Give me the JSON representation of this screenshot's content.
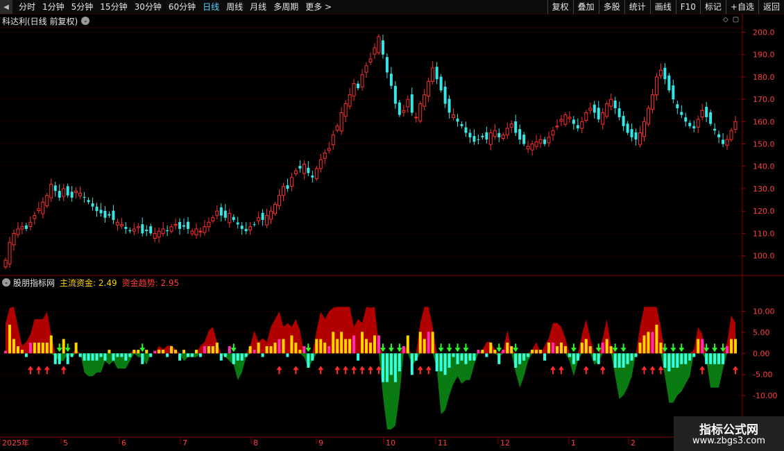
{
  "toolbar": {
    "back_glyph": "◀",
    "periods": [
      "分时",
      "1分钟",
      "5分钟",
      "15分钟",
      "30分钟",
      "60分钟",
      "日线",
      "周线",
      "月线",
      "多周期",
      "更多 >"
    ],
    "active_period": "日线",
    "buttons": [
      "复权",
      "叠加",
      "多股",
      "统计",
      "画线",
      "F10",
      "标记",
      "+自选",
      "返回"
    ]
  },
  "main_chart": {
    "title": "科达利(日线 前复权)",
    "dropdown_glyph": "⌄",
    "price_axis": {
      "labels": [
        "200.0",
        "190.0",
        "180.0",
        "170.0",
        "160.0",
        "150.0",
        "140.0",
        "130.0",
        "120.0",
        "110.0",
        "100.0"
      ],
      "values": [
        200,
        190,
        180,
        170,
        160,
        150,
        140,
        130,
        120,
        110,
        100
      ],
      "range": [
        91.5,
        202
      ]
    },
    "up_color": "#ff3030",
    "down_color": "#36e6e6",
    "candles_close": [
      98,
      106,
      110,
      112,
      113,
      112,
      115,
      118,
      121,
      124,
      127,
      132,
      129,
      126,
      130,
      127,
      126,
      129,
      128,
      126,
      124,
      122,
      120,
      119,
      117,
      118,
      116,
      115,
      114,
      112,
      111,
      112,
      113,
      110,
      111,
      110,
      110,
      111,
      112,
      111,
      113,
      114,
      112,
      113,
      112,
      111,
      112,
      111,
      113,
      115,
      117,
      120,
      118,
      117,
      119,
      116,
      114,
      112,
      111,
      113,
      114,
      117,
      116,
      118,
      120,
      123,
      127,
      131,
      130,
      135,
      138,
      139,
      141,
      137,
      135,
      139,
      143,
      146,
      148,
      154,
      158,
      164,
      168,
      172,
      177,
      175,
      181,
      185,
      188,
      193,
      198,
      190,
      182,
      176,
      168,
      163,
      165,
      170,
      164,
      162,
      168,
      172,
      178,
      184,
      179,
      174,
      168,
      164,
      163,
      160,
      158,
      155,
      153,
      151,
      152,
      153,
      152,
      155,
      156,
      153,
      154,
      157,
      159,
      155,
      152,
      150,
      149,
      150,
      151,
      152,
      150,
      153,
      156,
      158,
      161,
      163,
      162,
      159,
      157,
      160,
      164,
      166,
      164,
      161,
      164,
      168,
      170,
      166,
      162,
      158,
      155,
      153,
      152,
      155,
      160,
      166,
      172,
      180,
      183,
      179,
      174,
      170,
      166,
      163,
      160,
      158,
      157,
      161,
      165,
      162,
      159,
      156,
      153,
      150,
      152,
      156,
      160
    ],
    "indicator_name": "股朋指标网",
    "legend": [
      {
        "label": "主流资金: 2.49",
        "color": "#ffd400"
      },
      {
        "label": "资金趋势: 2.95",
        "color": "#ff3b3b"
      }
    ]
  },
  "indicator_chart": {
    "axis": {
      "labels": [
        "10.00",
        "5.00",
        "0.00",
        "-5.00",
        "-10.00"
      ],
      "values": [
        10,
        5,
        0,
        -5,
        -10
      ],
      "range": [
        -19.5,
        15
      ]
    },
    "pos_bar_color": "#ffd400",
    "pos_bar_alt_color": "#ff2fb0",
    "neg_bar_color": "#36ffe0",
    "area_pos_color": "#b00000",
    "area_neg_color": "#0a7a12",
    "buy_arrow_color": "#ff2a2a",
    "sell_arrow_color": "#2aff2a"
  },
  "time_axis": {
    "labels": [
      "2025年",
      "5",
      "6",
      "7",
      "8",
      "9",
      "10",
      "11",
      "12",
      "1",
      "2"
    ]
  },
  "watermark": {
    "title": "指标公式网",
    "url": "www.zbgs3.com"
  }
}
